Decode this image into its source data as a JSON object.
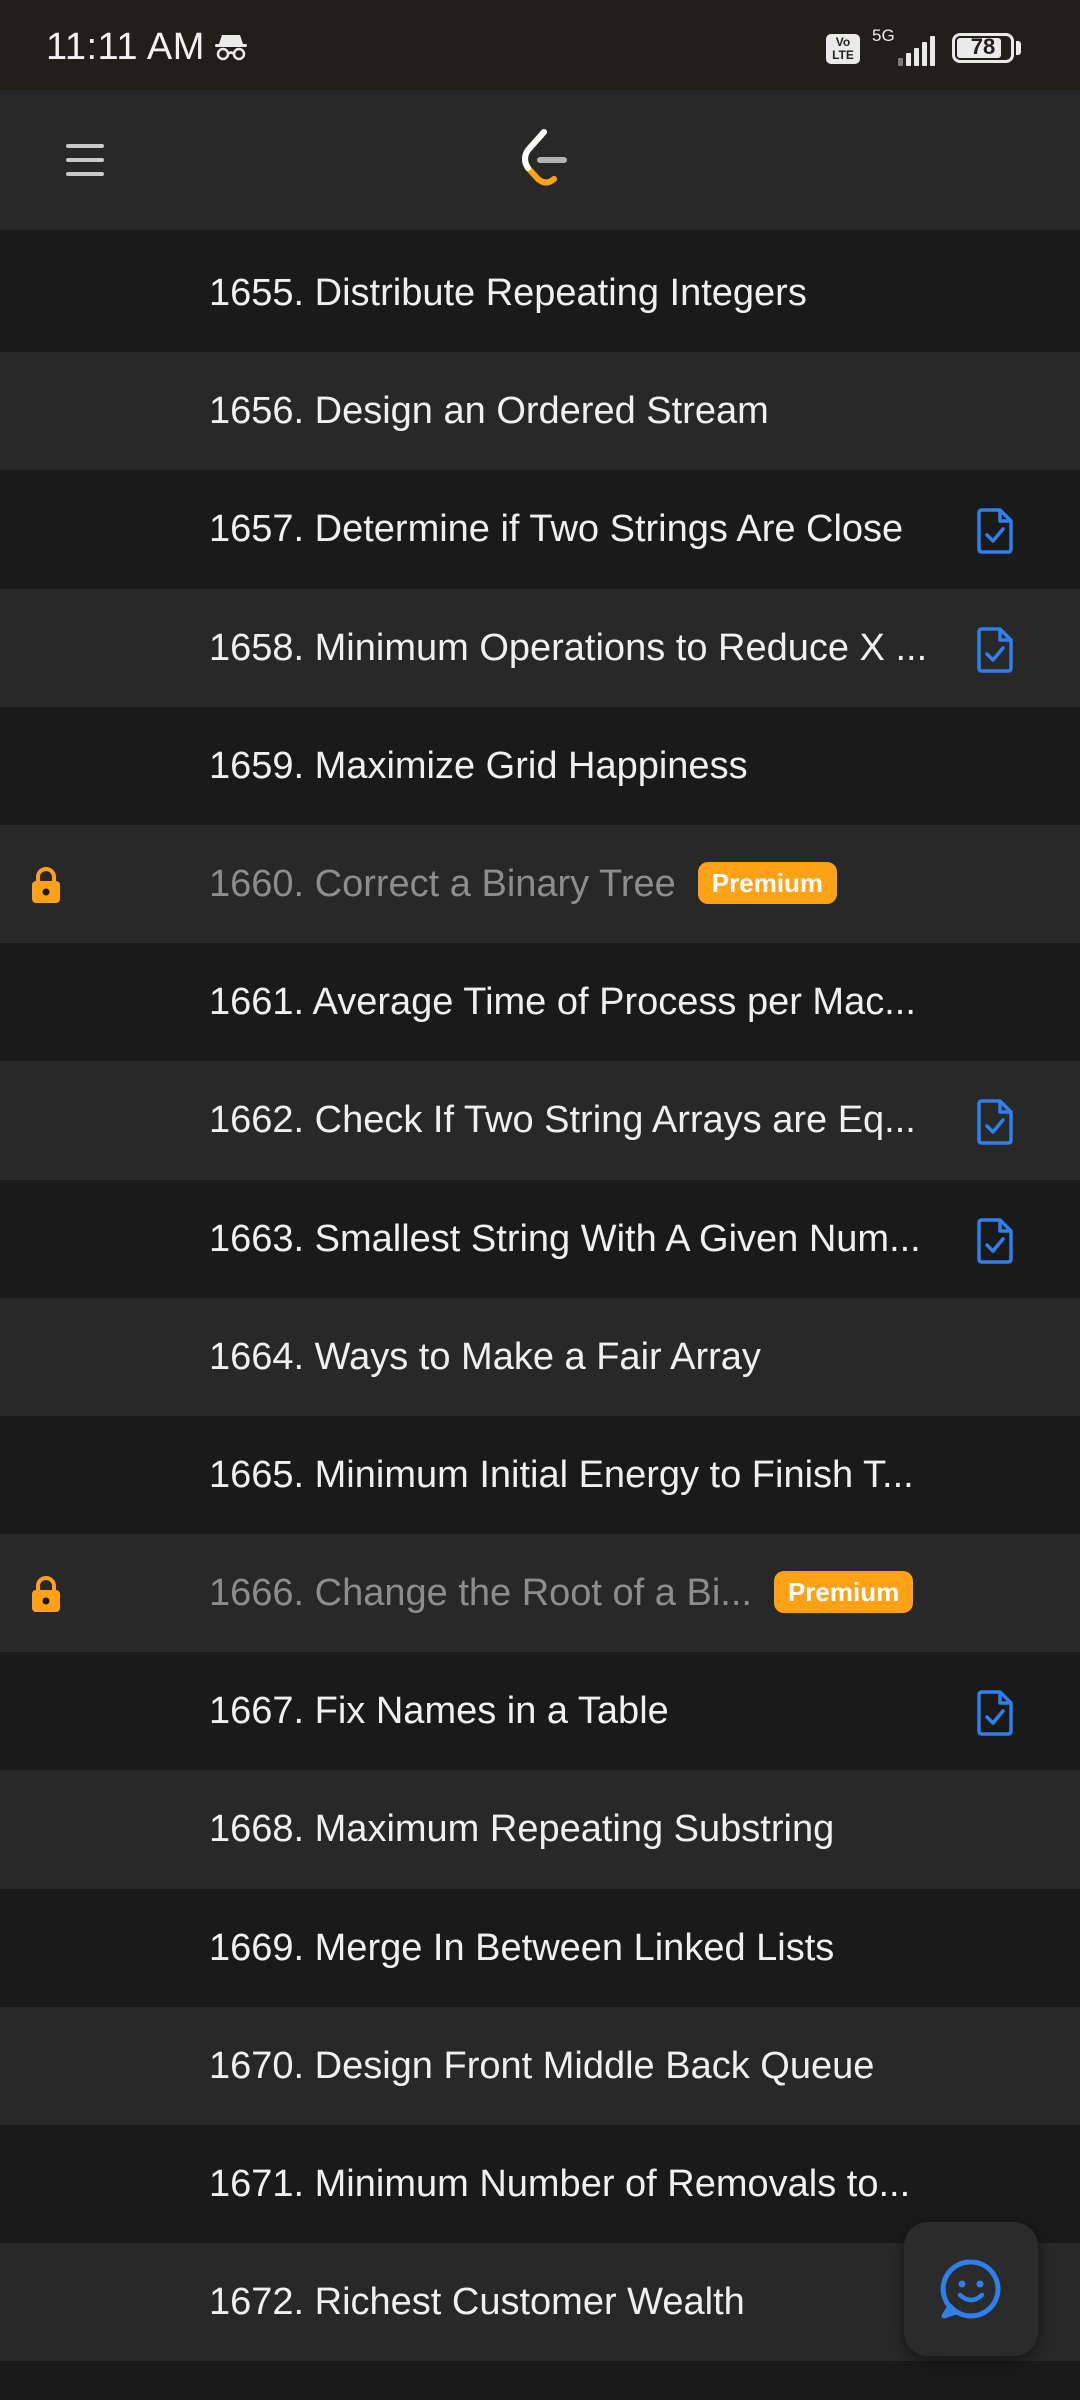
{
  "status_bar": {
    "time": "11:11 AM",
    "incognito_icon": "incognito-icon",
    "volte_label": "Vo\nLTE",
    "network": "5G",
    "battery_level": "78",
    "battery_fraction": 0.78
  },
  "app_bar": {
    "menu_icon": "hamburger-menu-icon",
    "logo_icon": "leetcode-logo"
  },
  "colors": {
    "accent_orange": "#ffa116",
    "solved_blue": "#2f80ed",
    "row_dark": "#1a1a1a",
    "row_light": "#282828"
  },
  "problems": [
    {
      "title": "1655. Distribute Repeating Integers",
      "solved": false,
      "locked": false
    },
    {
      "title": "1656. Design an Ordered Stream",
      "solved": false,
      "locked": false
    },
    {
      "title": "1657. Determine if Two Strings Are Close",
      "solved": true,
      "locked": false
    },
    {
      "title": "1658. Minimum Operations to Reduce X ...",
      "solved": true,
      "locked": false
    },
    {
      "title": "1659. Maximize Grid Happiness",
      "solved": false,
      "locked": false
    },
    {
      "title": "1660. Correct a Binary Tree",
      "solved": false,
      "locked": true,
      "badge": "Premium"
    },
    {
      "title": "1661. Average Time of Process per Mac...",
      "solved": false,
      "locked": false
    },
    {
      "title": "1662. Check If Two String Arrays are Eq...",
      "solved": true,
      "locked": false
    },
    {
      "title": "1663. Smallest String With A Given Num...",
      "solved": true,
      "locked": false
    },
    {
      "title": "1664. Ways to Make a Fair Array",
      "solved": false,
      "locked": false
    },
    {
      "title": "1665. Minimum Initial Energy to Finish T...",
      "solved": false,
      "locked": false
    },
    {
      "title": "1666. Change the Root of a Bi...",
      "solved": false,
      "locked": true,
      "badge": "Premium"
    },
    {
      "title": "1667. Fix Names in a Table",
      "solved": true,
      "locked": false
    },
    {
      "title": "1668. Maximum Repeating Substring",
      "solved": false,
      "locked": false
    },
    {
      "title": "1669. Merge In Between Linked Lists",
      "solved": false,
      "locked": false
    },
    {
      "title": "1670. Design Front Middle Back Queue",
      "solved": false,
      "locked": false
    },
    {
      "title": "1671. Minimum Number of Removals to...",
      "solved": false,
      "locked": false
    },
    {
      "title": "1672. Richest Customer Wealth",
      "solved": false,
      "locked": false
    }
  ],
  "chat_button": {
    "icon": "smiley-chat-icon"
  }
}
